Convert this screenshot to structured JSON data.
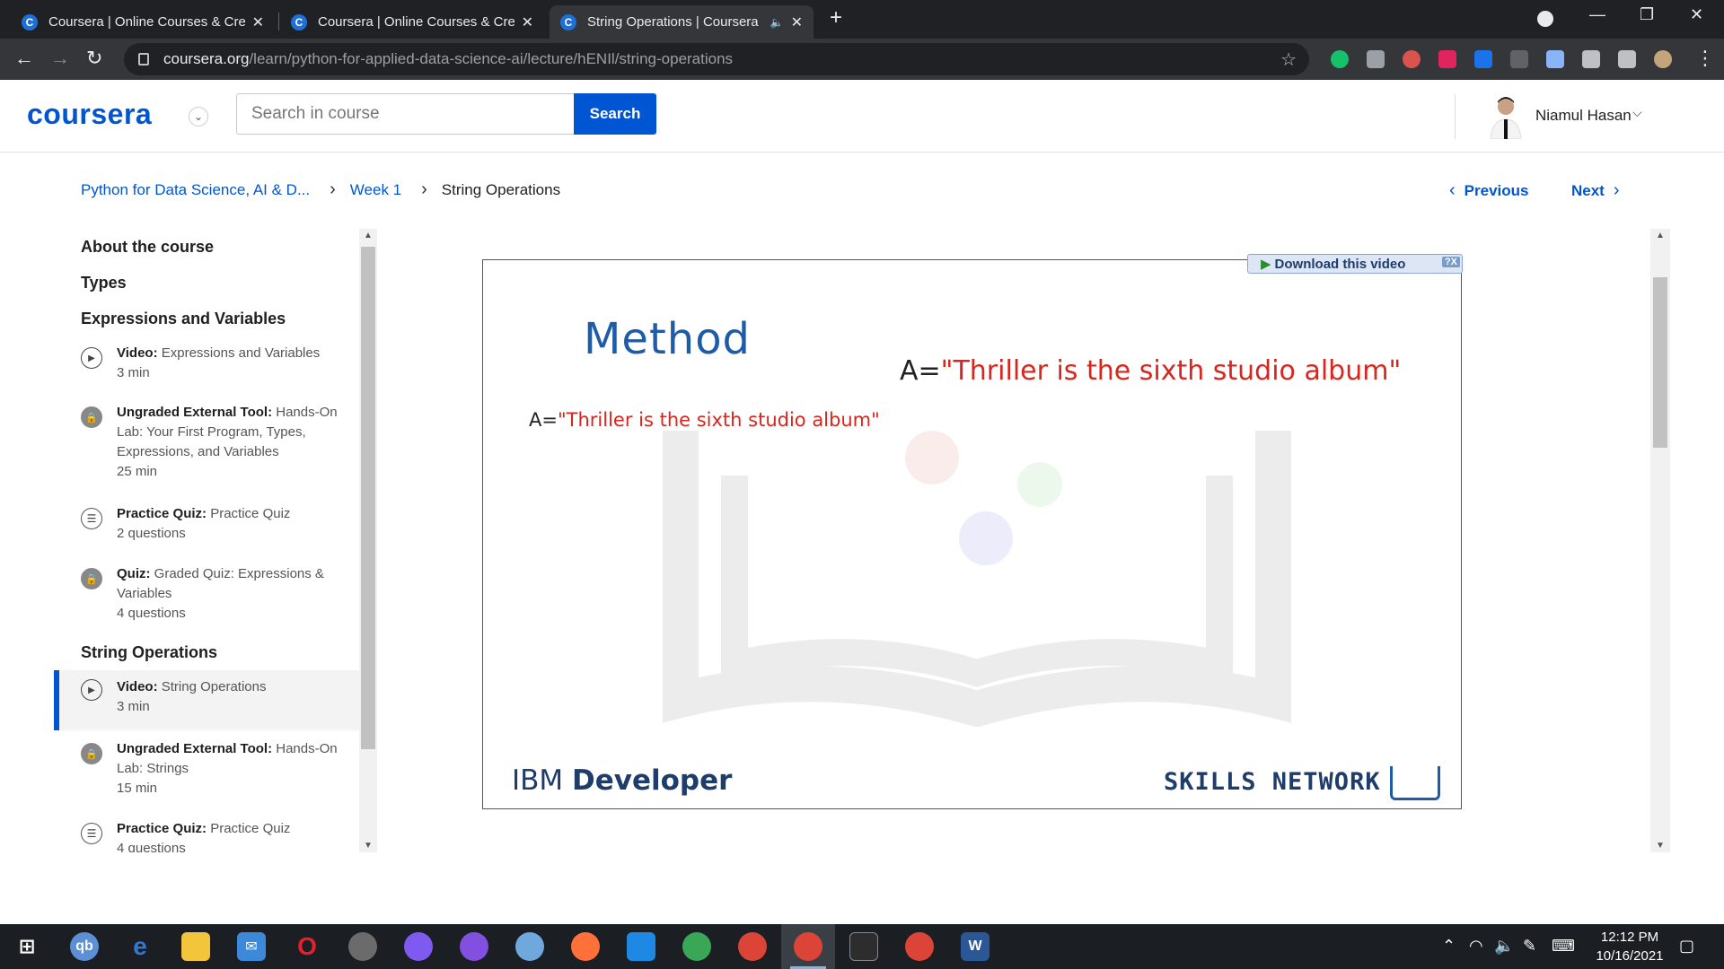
{
  "browser": {
    "tabs": [
      {
        "title": "Coursera | Online Courses & Credentials",
        "active": false
      },
      {
        "title": "Coursera | Online Courses & Credentials",
        "active": false
      },
      {
        "title": "String Operations | Coursera",
        "active": true
      }
    ],
    "url_domain": "coursera.org",
    "url_path": "/learn/python-for-applied-data-science-ai/lecture/hENIl/string-operations"
  },
  "header": {
    "logo": "coursera",
    "search_placeholder": "Search in course",
    "search_button": "Search",
    "user_name": "Niamul Hasan"
  },
  "breadcrumb": {
    "course": "Python for Data Science, AI & D...",
    "week": "Week 1",
    "current": "String Operations"
  },
  "nav": {
    "previous": "Previous",
    "next": "Next"
  },
  "sidebar": {
    "sections": [
      "About the course",
      "Types",
      "Expressions and Variables",
      "String Operations"
    ],
    "items": [
      {
        "type": "Video:",
        "title": "Expressions and Variables",
        "meta": "3 min",
        "icon": "play-icon"
      },
      {
        "type": "Ungraded External Tool:",
        "title": "Hands-On Lab: Your First Program, Types, Expressions, and Variables",
        "meta": "25 min",
        "icon": "lock-icon"
      },
      {
        "type": "Practice Quiz:",
        "title": "Practice Quiz",
        "meta": "2 questions",
        "icon": "quiz-icon"
      },
      {
        "type": "Quiz:",
        "title": "Graded Quiz: Expressions & Variables",
        "meta": "4 questions",
        "icon": "lock-icon"
      },
      {
        "type": "Video:",
        "title": "String Operations",
        "meta": "3 min",
        "icon": "play-icon",
        "selected": true
      },
      {
        "type": "Ungraded External Tool:",
        "title": "Hands-On Lab: Strings",
        "meta": "15 min",
        "icon": "lock-icon"
      },
      {
        "type": "Practice Quiz:",
        "title": "Practice Quiz",
        "meta": "4 questions",
        "icon": "quiz-icon"
      }
    ]
  },
  "video": {
    "download_label": "Download this video",
    "download_extra": "?X",
    "slide_title": "Method",
    "code_big_var": "A=",
    "code_big_str": "\"Thriller is the sixth studio album\"",
    "code_small_var": "A=",
    "code_small_str": "\"Thriller is the sixth studio album\"",
    "ibm_light": "IBM ",
    "ibm_bold": "Developer",
    "skills": "SKILLS NETWORK"
  },
  "taskbar": {
    "time": "12:12 PM",
    "date": "10/16/2021"
  }
}
